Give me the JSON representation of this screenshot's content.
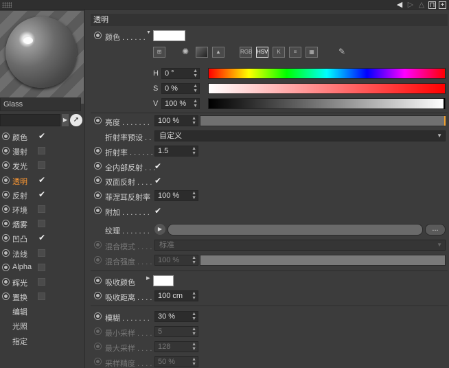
{
  "topbar": {
    "icons": [
      "back-arrow",
      "forward-arrow",
      "up-arrow",
      "lock",
      "new-panel"
    ]
  },
  "preview": {
    "material_name": "Glass"
  },
  "channels": [
    {
      "label": "颜色",
      "checked": true
    },
    {
      "label": "漫射",
      "checked": false
    },
    {
      "label": "发光",
      "checked": false
    },
    {
      "label": "透明",
      "checked": true,
      "active": true
    },
    {
      "label": "反射",
      "checked": true
    },
    {
      "label": "环境",
      "checked": false
    },
    {
      "label": "烟雾",
      "checked": false
    },
    {
      "label": "凹凸",
      "checked": true
    },
    {
      "label": "法线",
      "checked": false
    },
    {
      "label": "Alpha",
      "checked": false
    },
    {
      "label": "辉光",
      "checked": false
    },
    {
      "label": "置换",
      "checked": false
    }
  ],
  "extra_items": [
    "编辑",
    "光照",
    "指定"
  ],
  "section": {
    "title": "透明"
  },
  "color": {
    "label": "颜色 . . . . . .",
    "swatch": "#ffffff",
    "modes": [
      "RGB",
      "HSV",
      "K"
    ],
    "h_label": "H",
    "h_value": "0 °",
    "s_label": "S",
    "s_value": "0 %",
    "v_label": "V",
    "v_value": "100 %"
  },
  "fields": {
    "brightness_label": "亮度 . . . . . . .",
    "brightness_value": "100 %",
    "ior_preset_label": "折射率预设 . .",
    "ior_preset_value": "自定义",
    "ior_label": "折射率 . . . . . .",
    "ior_value": "1.5",
    "total_internal_label": "全内部反射 . . .",
    "double_sided_label": "双面反射 . . . .",
    "fresnel_label": "菲涅耳反射率",
    "fresnel_value": "100 %",
    "additive_label": "附加 . . . . . . .",
    "texture_label": "纹理 . . . . . . .",
    "texture_more": "...",
    "blend_mode_label": "混合模式 . . . .",
    "blend_mode_value": "标准",
    "blend_strength_label": "混合强度 . . . .",
    "blend_strength_value": "100 %",
    "absorb_color_label": "吸收颜色",
    "absorb_color": "#ffffff",
    "absorb_dist_label": "吸收距离 . . . .",
    "absorb_dist_value": "100 cm",
    "blur_label": "模糊 . . . . . . .",
    "blur_value": "30 %",
    "min_samples_label": "最小采样 . . . .",
    "min_samples_value": "5",
    "max_samples_label": "最大采样 . . . .",
    "max_samples_value": "128",
    "sample_precision_label": "采样精度 . . . .",
    "sample_precision_value": "50 %"
  }
}
